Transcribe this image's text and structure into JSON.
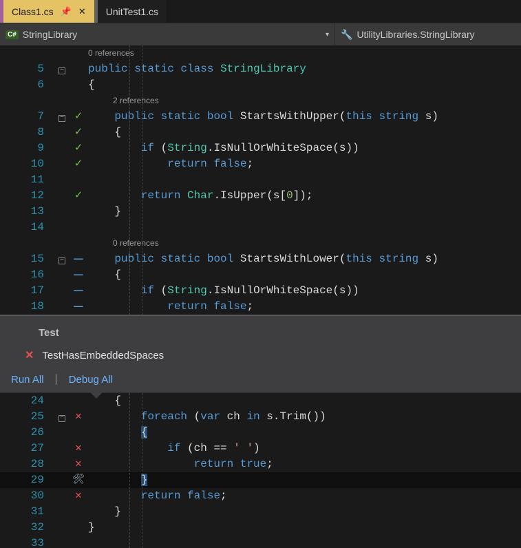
{
  "tabs": {
    "active": {
      "label": "Class1.cs"
    },
    "inactive": {
      "label": "UnitTest1.cs"
    }
  },
  "navbar": {
    "left": "StringLibrary",
    "right": "UtilityLibraries.StringLibrary"
  },
  "refs": {
    "class": "0 references",
    "m1": "2 references",
    "m2": "0 references"
  },
  "code": {
    "l5": "public static class StringLibrary",
    "l6": "{",
    "l7": "    public static bool StartsWithUpper(this string s)",
    "l8": "    {",
    "l9": "        if (String.IsNullOrWhiteSpace(s))",
    "l10": "            return false;",
    "l11": "",
    "l12": "        return Char.IsUpper(s[0]);",
    "l13": "    }",
    "l14": "",
    "l15": "    public static bool StartsWithLower(this string s)",
    "l16": "    {",
    "l17": "        if (String.IsNullOrWhiteSpace(s))",
    "l18": "            return false;",
    "l24": "    {",
    "l25": "        foreach (var ch in s.Trim())",
    "l26": "        {",
    "l27": "            if (ch == ' ')",
    "l28": "                return true;",
    "l29": "        }",
    "l30": "        return false;",
    "l31": "    }",
    "l32": "}",
    "l33": ""
  },
  "lineNumbers": {
    "l5": "5",
    "l6": "6",
    "l7": "7",
    "l8": "8",
    "l9": "9",
    "l10": "10",
    "l11": "11",
    "l12": "12",
    "l13": "13",
    "l14": "14",
    "l15": "15",
    "l16": "16",
    "l17": "17",
    "l18": "18",
    "l24": "24",
    "l25": "25",
    "l26": "26",
    "l27": "27",
    "l28": "28",
    "l29": "29",
    "l30": "30",
    "l31": "31",
    "l32": "32",
    "l33": "33"
  },
  "popup": {
    "title": "Test",
    "testName": "TestHasEmbeddedSpaces",
    "runAll": "Run All",
    "debugAll": "Debug All"
  }
}
